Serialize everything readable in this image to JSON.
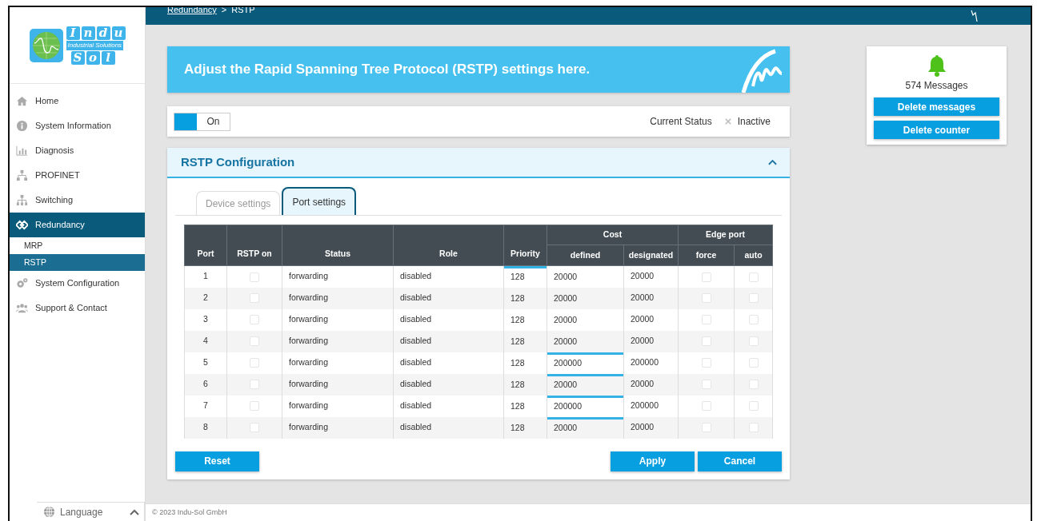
{
  "logo": {
    "top_letters": [
      "I",
      "n",
      "d",
      "u"
    ],
    "tagline": "Industrial Solutions",
    "bottom_letters": [
      "S",
      "o",
      "l"
    ]
  },
  "sidebar": {
    "items": [
      {
        "label": "Home",
        "kind": "home",
        "selected": false
      },
      {
        "label": "System Information",
        "kind": "info",
        "selected": false
      },
      {
        "label": "Diagnosis",
        "kind": "chart",
        "selected": false
      },
      {
        "label": "PROFINET",
        "kind": "network",
        "selected": false
      },
      {
        "label": "Switching",
        "kind": "tree",
        "selected": false
      },
      {
        "label": "Redundancy",
        "kind": "diamond",
        "selected": true,
        "children": [
          {
            "label": "MRP",
            "selected": false
          },
          {
            "label": "RSTP",
            "selected": true
          }
        ]
      },
      {
        "label": "System Configuration",
        "kind": "gears",
        "selected": false
      },
      {
        "label": "Support & Contact",
        "kind": "people",
        "selected": false
      }
    ],
    "language": {
      "label": "Language",
      "expanded": true
    }
  },
  "breadcrumb": {
    "link": "Redundancy",
    "separator": ">",
    "current": "RSTP"
  },
  "banner": {
    "text": "Adjust the Rapid Spanning Tree Protocol (RSTP) settings here."
  },
  "switch": {
    "on": true,
    "label": "On"
  },
  "status": {
    "label": "Current Status",
    "value": "Inactive"
  },
  "config": {
    "title": "RSTP Configuration",
    "expanded": true,
    "tabs": [
      {
        "label": "Device settings",
        "selected": false
      },
      {
        "label": "Port settings",
        "selected": true
      }
    ],
    "columns": [
      {
        "label": "Port"
      },
      {
        "label": "RSTP on"
      },
      {
        "label": "Status"
      },
      {
        "label": "Role"
      },
      {
        "label": "Priority"
      },
      {
        "label": "Cost",
        "subcolumns": [
          "defined",
          "designated"
        ]
      },
      {
        "label": "Edge port",
        "subcolumns": [
          "force",
          "auto"
        ]
      }
    ],
    "rows": [
      {
        "port": "1",
        "rstp_on": false,
        "status": "forwarding",
        "role": "disabled",
        "priority": "128",
        "priority_marked": true,
        "cost_defined": "20000",
        "defined_marked": false,
        "cost_designated": "20000",
        "edge_force": false,
        "edge_auto": false
      },
      {
        "port": "2",
        "rstp_on": false,
        "status": "forwarding",
        "role": "disabled",
        "priority": "128",
        "priority_marked": false,
        "cost_defined": "20000",
        "defined_marked": false,
        "cost_designated": "20000",
        "edge_force": false,
        "edge_auto": false
      },
      {
        "port": "3",
        "rstp_on": false,
        "status": "forwarding",
        "role": "disabled",
        "priority": "128",
        "priority_marked": false,
        "cost_defined": "20000",
        "defined_marked": false,
        "cost_designated": "20000",
        "edge_force": false,
        "edge_auto": false
      },
      {
        "port": "4",
        "rstp_on": false,
        "status": "forwarding",
        "role": "disabled",
        "priority": "128",
        "priority_marked": false,
        "cost_defined": "20000",
        "defined_marked": false,
        "cost_designated": "20000",
        "edge_force": false,
        "edge_auto": false
      },
      {
        "port": "5",
        "rstp_on": false,
        "status": "forwarding",
        "role": "disabled",
        "priority": "128",
        "priority_marked": false,
        "cost_defined": "200000",
        "defined_marked": true,
        "cost_designated": "200000",
        "edge_force": false,
        "edge_auto": false
      },
      {
        "port": "6",
        "rstp_on": false,
        "status": "forwarding",
        "role": "disabled",
        "priority": "128",
        "priority_marked": false,
        "cost_defined": "20000",
        "defined_marked": true,
        "cost_designated": "20000",
        "edge_force": false,
        "edge_auto": false
      },
      {
        "port": "7",
        "rstp_on": false,
        "status": "forwarding",
        "role": "disabled",
        "priority": "128",
        "priority_marked": false,
        "cost_defined": "200000",
        "defined_marked": true,
        "cost_designated": "200000",
        "edge_force": false,
        "edge_auto": false
      },
      {
        "port": "8",
        "rstp_on": false,
        "status": "forwarding",
        "role": "disabled",
        "priority": "128",
        "priority_marked": false,
        "cost_defined": "20000",
        "defined_marked": true,
        "cost_designated": "20000",
        "edge_force": false,
        "edge_auto": false
      }
    ],
    "left_buttons": [
      "Reset"
    ],
    "right_buttons": [
      "Apply",
      "Cancel"
    ]
  },
  "messages": {
    "count": "574 Messages",
    "buttons": [
      "Delete messages",
      "Delete counter"
    ]
  },
  "footer": {
    "copyright": "© 2023 Indu-Sol GmbH"
  }
}
